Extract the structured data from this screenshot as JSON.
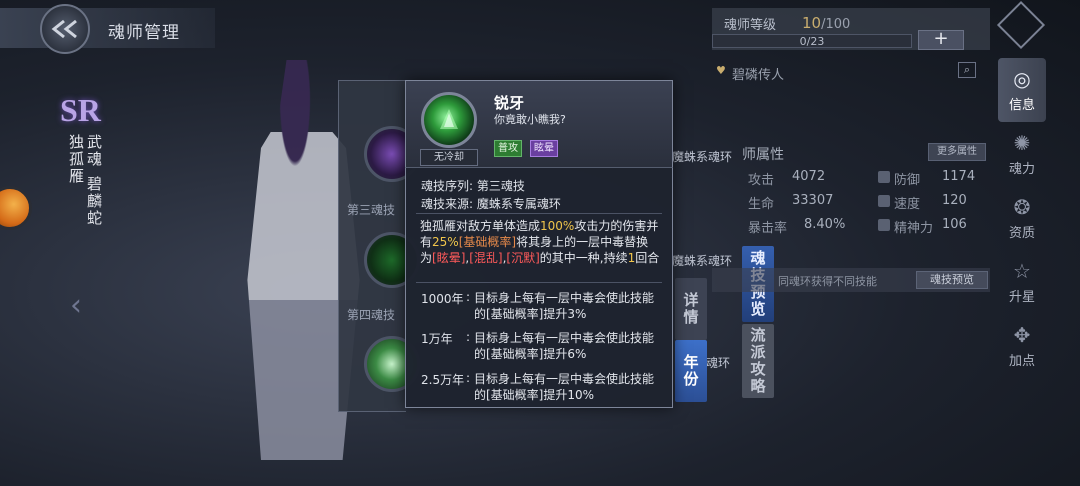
{
  "header": {
    "title": "魂师管理"
  },
  "character": {
    "rarity": "SR",
    "name": "独孤雁",
    "martial_soul_label": "武魂",
    "martial_soul": "碧麟蛇"
  },
  "skill_list": {
    "section3": "第三魂技",
    "section4": "第四魂技",
    "ring_text_1": "魔蛛系魂环",
    "ring_text_2": "魔蛛系魂环",
    "ring_text_3": "魂环",
    "hint_text": "同魂环获得不同技能"
  },
  "tabs": {
    "details": "详情",
    "year": "年份",
    "skill_preview": "魂技预览",
    "school_strategy": "流派攻略"
  },
  "right_panel": {
    "level_label": "魂师等级",
    "level_current": "10",
    "level_max": "/100",
    "exp_text": "0/23",
    "plus": "+",
    "ring_name": "碧磷传人",
    "stats_title": "师属性",
    "more_stats": "更多属性",
    "preview_btn": "魂技预览",
    "stats": [
      {
        "label": "攻击",
        "value": "4072"
      },
      {
        "label": "防御",
        "value": "1174"
      },
      {
        "label": "生命",
        "value": "33307"
      },
      {
        "label": "速度",
        "value": "120"
      },
      {
        "label": "暴击率",
        "value": "8.40%"
      },
      {
        "label": "精神力",
        "value": "106"
      }
    ]
  },
  "side_nav": [
    {
      "label": "信息",
      "glyph": "◎"
    },
    {
      "label": "魂力",
      "glyph": "✺"
    },
    {
      "label": "资质",
      "glyph": "❂"
    },
    {
      "label": "升星",
      "glyph": "☆"
    },
    {
      "label": "加点",
      "glyph": "✥"
    }
  ],
  "popup": {
    "skill_name": "锐牙",
    "quote": "你竟敢小瞧我?",
    "cooldown": "无冷却",
    "tags": [
      "普攻",
      "眩晕"
    ],
    "sequence_label": "魂技序列:",
    "sequence_value": "第三魂技",
    "source_label": "魂技来源:",
    "source_value": "魔蛛系专属魂环",
    "description": {
      "p1": "独孤雁对敌方单体造成",
      "p2": "100%",
      "p3": "攻击力的伤害并有",
      "p4": "25%",
      "p5": "[基础概率]",
      "p6": "将其身上的一层中毒替换为",
      "p7": "[眩晕]",
      "p8": ",",
      "p9": "[混乱]",
      "p10": ",",
      "p11": "[沉默]",
      "p12": "的其中一种,持续",
      "p13": "1",
      "p14": "回合"
    },
    "years": [
      {
        "year": "1000年",
        "desc": "目标身上每有一层中毒会使此技能的[基础概率]提升3%"
      },
      {
        "year": "1万年",
        "desc": "目标身上每有一层中毒会使此技能的[基础概率]提升6%"
      },
      {
        "year": "2.5万年",
        "desc": "目标身上每有一层中毒会使此技能的[基础概率]提升10%"
      }
    ],
    "colon": ":"
  },
  "colors": {
    "accent_blue": "#3d70c9",
    "highlight_yellow": "#f0c54b",
    "highlight_orange": "#e5894a",
    "highlight_red": "#ff5a5a",
    "tag_green": "#2e7d32",
    "tag_purple": "#6a3fa0"
  }
}
